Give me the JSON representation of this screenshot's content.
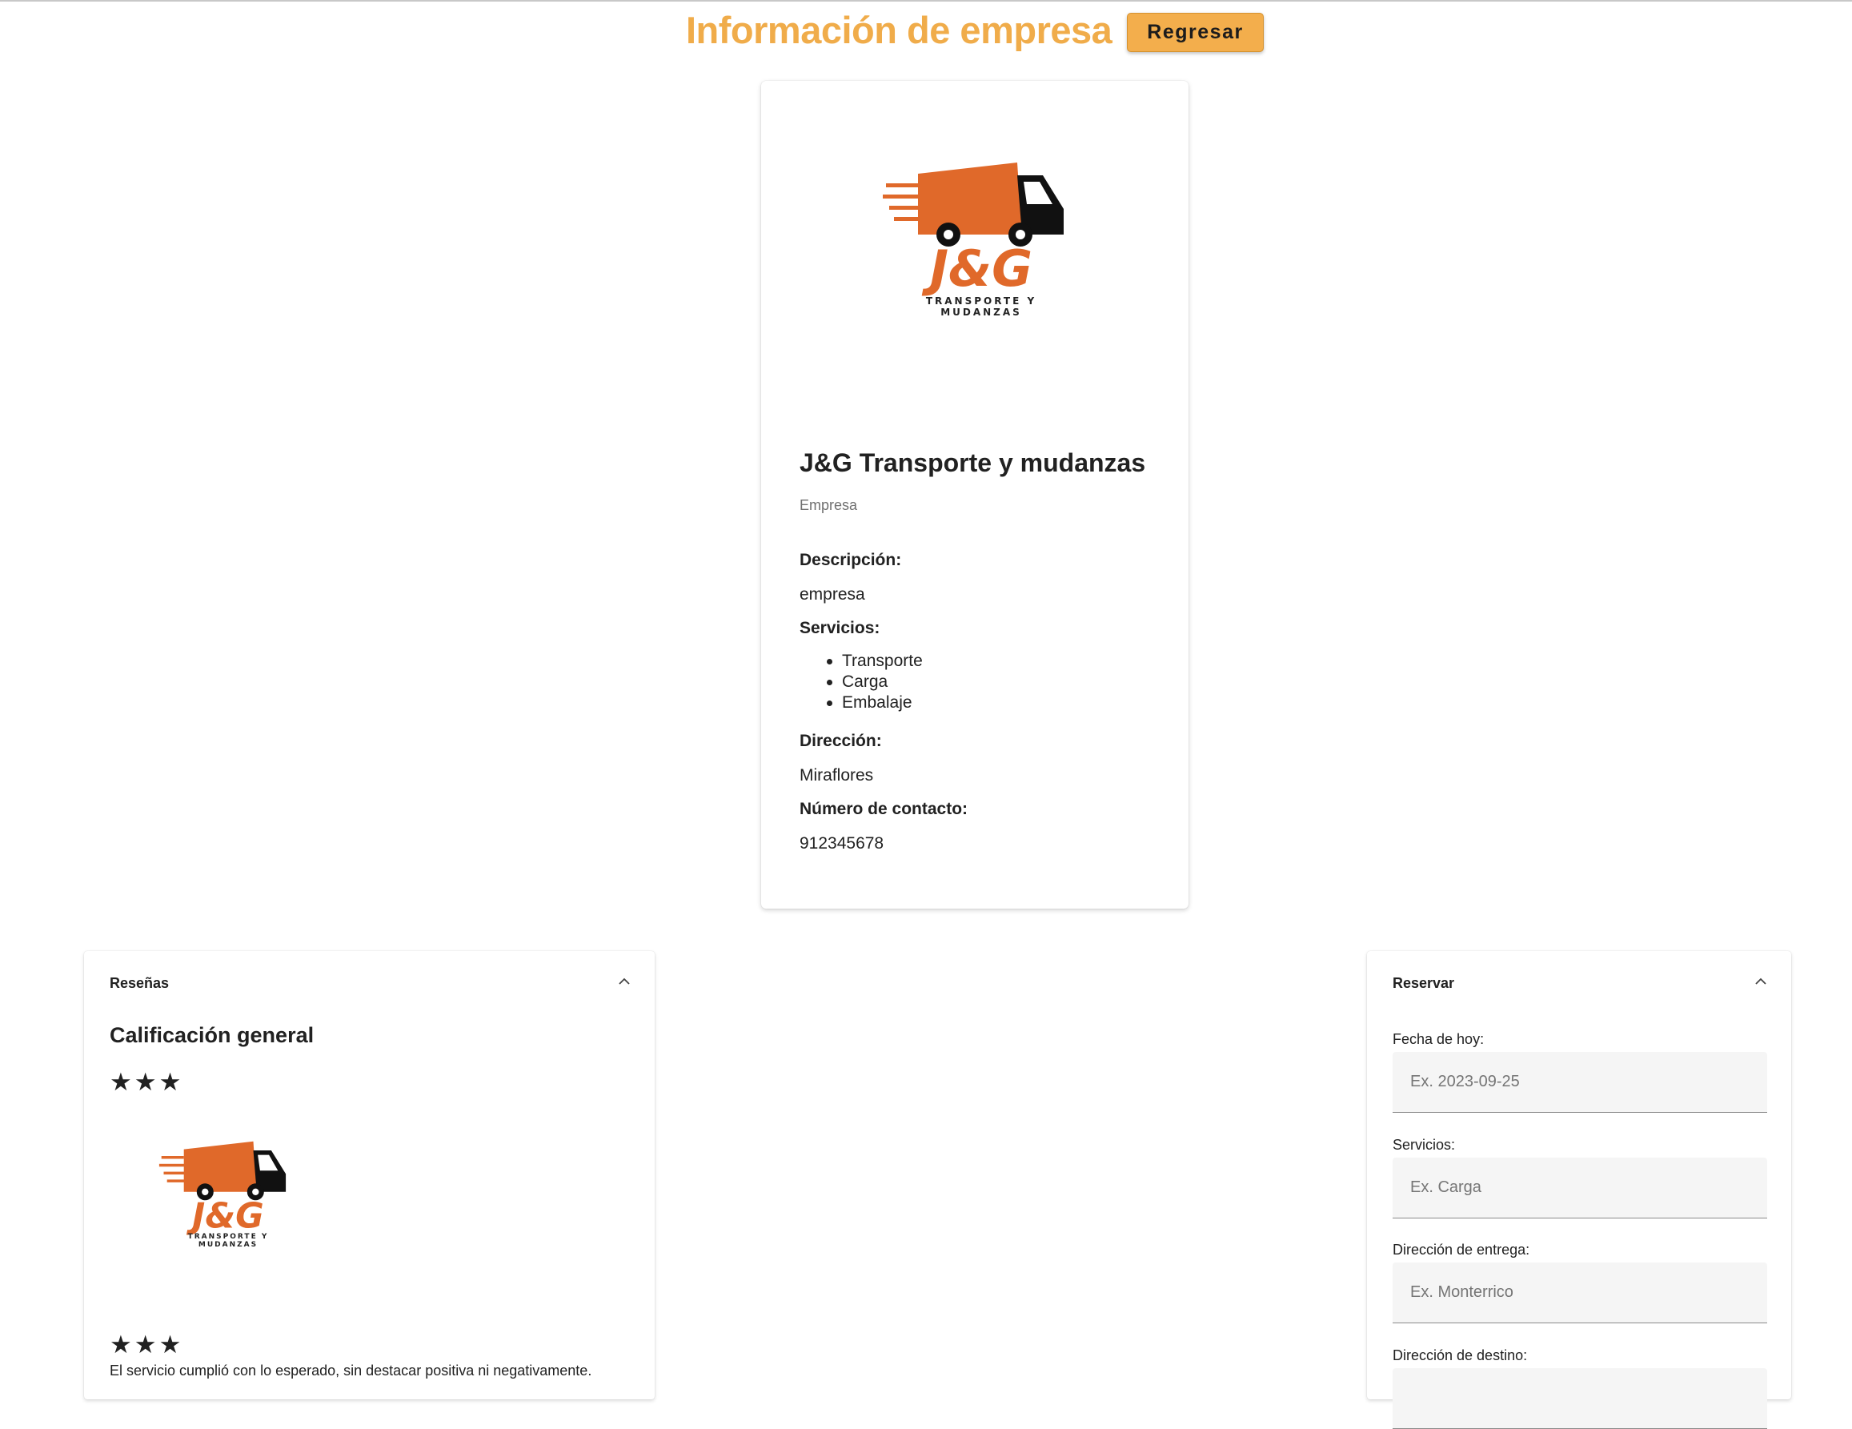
{
  "header": {
    "title": "Información de empresa",
    "back_label": "Regresar"
  },
  "company": {
    "logo_tagline": "TRANSPORTE Y MUDANZAS",
    "logo_letters": "J&G",
    "name": "J&G Transporte y mudanzas",
    "type": "Empresa",
    "description_label": "Descripción:",
    "description": "empresa",
    "services_label": "Servicios:",
    "services": [
      "Transporte",
      "Carga",
      "Embalaje"
    ],
    "address_label": "Dirección:",
    "address": "Miraflores",
    "contact_label": "Número de contacto:",
    "contact": "912345678"
  },
  "reviews": {
    "panel_title": "Reseñas",
    "overall_title": "Calificación general",
    "overall_rating": 3,
    "items": [
      {
        "rating": 3,
        "text": "El servicio cumplió con lo esperado, sin destacar positiva ni negativamente."
      }
    ]
  },
  "booking": {
    "panel_title": "Reservar",
    "fields": [
      {
        "label": "Fecha de hoy:",
        "placeholder": "Ex. 2023-09-25"
      },
      {
        "label": "Servicios:",
        "placeholder": "Ex. Carga"
      },
      {
        "label": "Dirección de entrega:",
        "placeholder": "Ex. Monterrico"
      },
      {
        "label": "Dirección de destino:",
        "placeholder": ""
      }
    ]
  },
  "colors": {
    "accent": "#f0ac4a",
    "button": "#f3ae4c",
    "logo_orange": "#e0692a",
    "logo_dark": "#111111"
  },
  "icons": {
    "star": "star-icon",
    "chevron": "chevron-up-icon"
  }
}
